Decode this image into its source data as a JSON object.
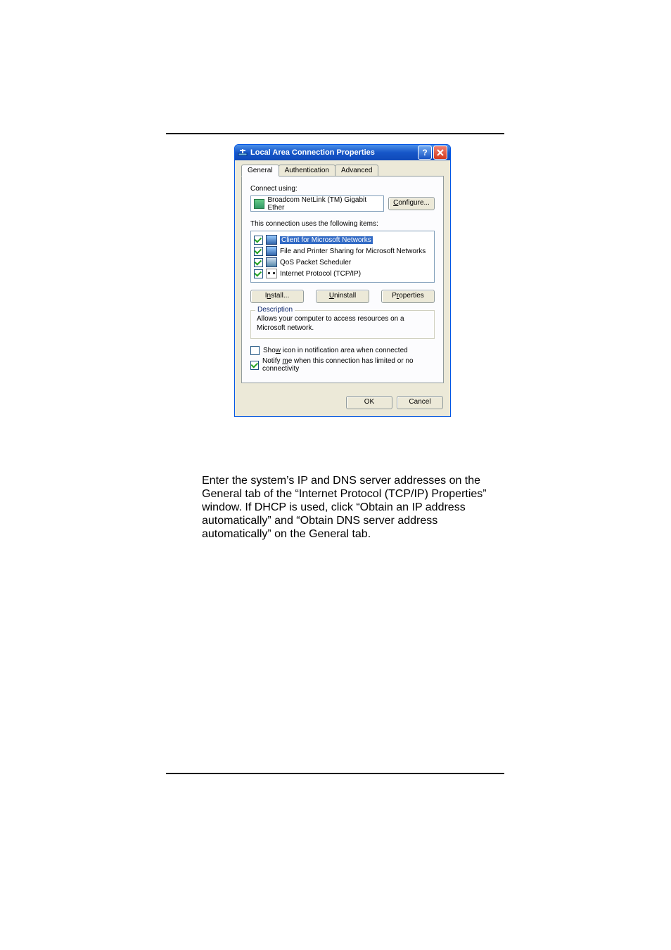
{
  "dialog": {
    "title": "Local Area Connection Properties",
    "tabs": {
      "general": "General",
      "authentication": "Authentication",
      "advanced": "Advanced"
    },
    "connect_using_label": "Connect using:",
    "adapter_name": "Broadcom NetLink (TM) Gigabit Ether",
    "configure_button": "Configure...",
    "items_label": "This connection uses the following items:",
    "items": [
      {
        "label": "Client for Microsoft Networks",
        "checked": true,
        "selected": true,
        "icon": "computer"
      },
      {
        "label": "File and Printer Sharing for Microsoft Networks",
        "checked": true,
        "selected": false,
        "icon": "share"
      },
      {
        "label": "QoS Packet Scheduler",
        "checked": true,
        "selected": false,
        "icon": "qos"
      },
      {
        "label": "Internet Protocol (TCP/IP)",
        "checked": true,
        "selected": false,
        "icon": "tcp"
      }
    ],
    "install_button": "Install...",
    "uninstall_button": "Uninstall",
    "properties_button": "Properties",
    "description_legend": "Description",
    "description_text": "Allows your computer to access resources on a Microsoft network.",
    "show_icon": {
      "checked": false,
      "label": "Show icon in notification area when connected"
    },
    "notify": {
      "checked": true,
      "label": "Notify me when this connection has limited or no connectivity"
    },
    "ok_button": "OK",
    "cancel_button": "Cancel"
  },
  "document": {
    "paragraph": "Enter the system’s IP and DNS server addresses on the General tab of the “Internet Protocol (TCP/IP) Properties” window.  If DHCP is used, click “Obtain an IP address automatically” and “Obtain DNS server address automatically” on the General tab."
  }
}
